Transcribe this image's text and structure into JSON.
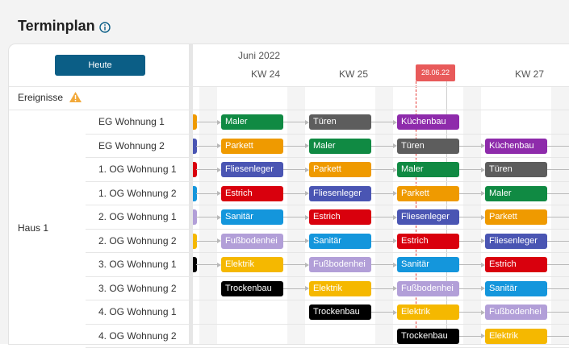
{
  "header": {
    "title": "Terminplan"
  },
  "today_button": "Heute",
  "timeline": {
    "month": "Juni 2022",
    "weeks": [
      "KW 24",
      "KW 25",
      "KW 27"
    ],
    "today_marker": "28.06.22"
  },
  "events_row_label": "Ereignisse",
  "group_label": "Haus 1",
  "rows": [
    "EG Wohnung 1",
    "EG Wohnung 2",
    "1. OG Wohnung 1",
    "1. OG Wohnung 2",
    "2. OG Wohnung 1",
    "2. OG Wohnung 2",
    "3. OG Wohnung 1",
    "3. OG Wohnung 2",
    "4. OG Wohnung 1",
    "4. OG Wohnung 2"
  ],
  "tasks": [
    [
      "",
      "Maler",
      "Türen",
      "Küchenbau",
      ""
    ],
    [
      "",
      "Parkett",
      "Maler",
      "Türen",
      "Küchenbau"
    ],
    [
      "",
      "Fliesenleger",
      "Parkett",
      "Maler",
      "Türen"
    ],
    [
      "",
      "Estrich",
      "Fliesenleger",
      "Parkett",
      "Maler"
    ],
    [
      "",
      "Sanitär",
      "Estrich",
      "Fliesenleger",
      "Parkett"
    ],
    [
      "",
      "Fußbodenhei",
      "Sanitär",
      "Estrich",
      "Fliesenleger"
    ],
    [
      "",
      "Elektrik",
      "Fußbodenhei",
      "Sanitär",
      "Estrich"
    ],
    [
      "",
      "Trockenbau",
      "Elektrik",
      "Fußbodenhei",
      "Sanitär"
    ],
    [
      "",
      "",
      "Trockenbau",
      "Elektrik",
      "Fußbodenhei"
    ],
    [
      "",
      "",
      "",
      "Trockenbau",
      "Elektrik"
    ]
  ],
  "colors": {
    "Maler": "#108a43",
    "Türen": "#5d5d5d",
    "Küchenbau": "#8e2bab",
    "Parkett": "#ef9a00",
    "Fliesenleger": "#4a55b3",
    "Estrich": "#d9000d",
    "Sanitär": "#1496dc",
    "Fußbodenhei": "#b29fd8",
    "Elektrik": "#f5b800",
    "Trockenbau": "#000000",
    "accent": "#0b5e86",
    "today": "#e85a5a"
  }
}
